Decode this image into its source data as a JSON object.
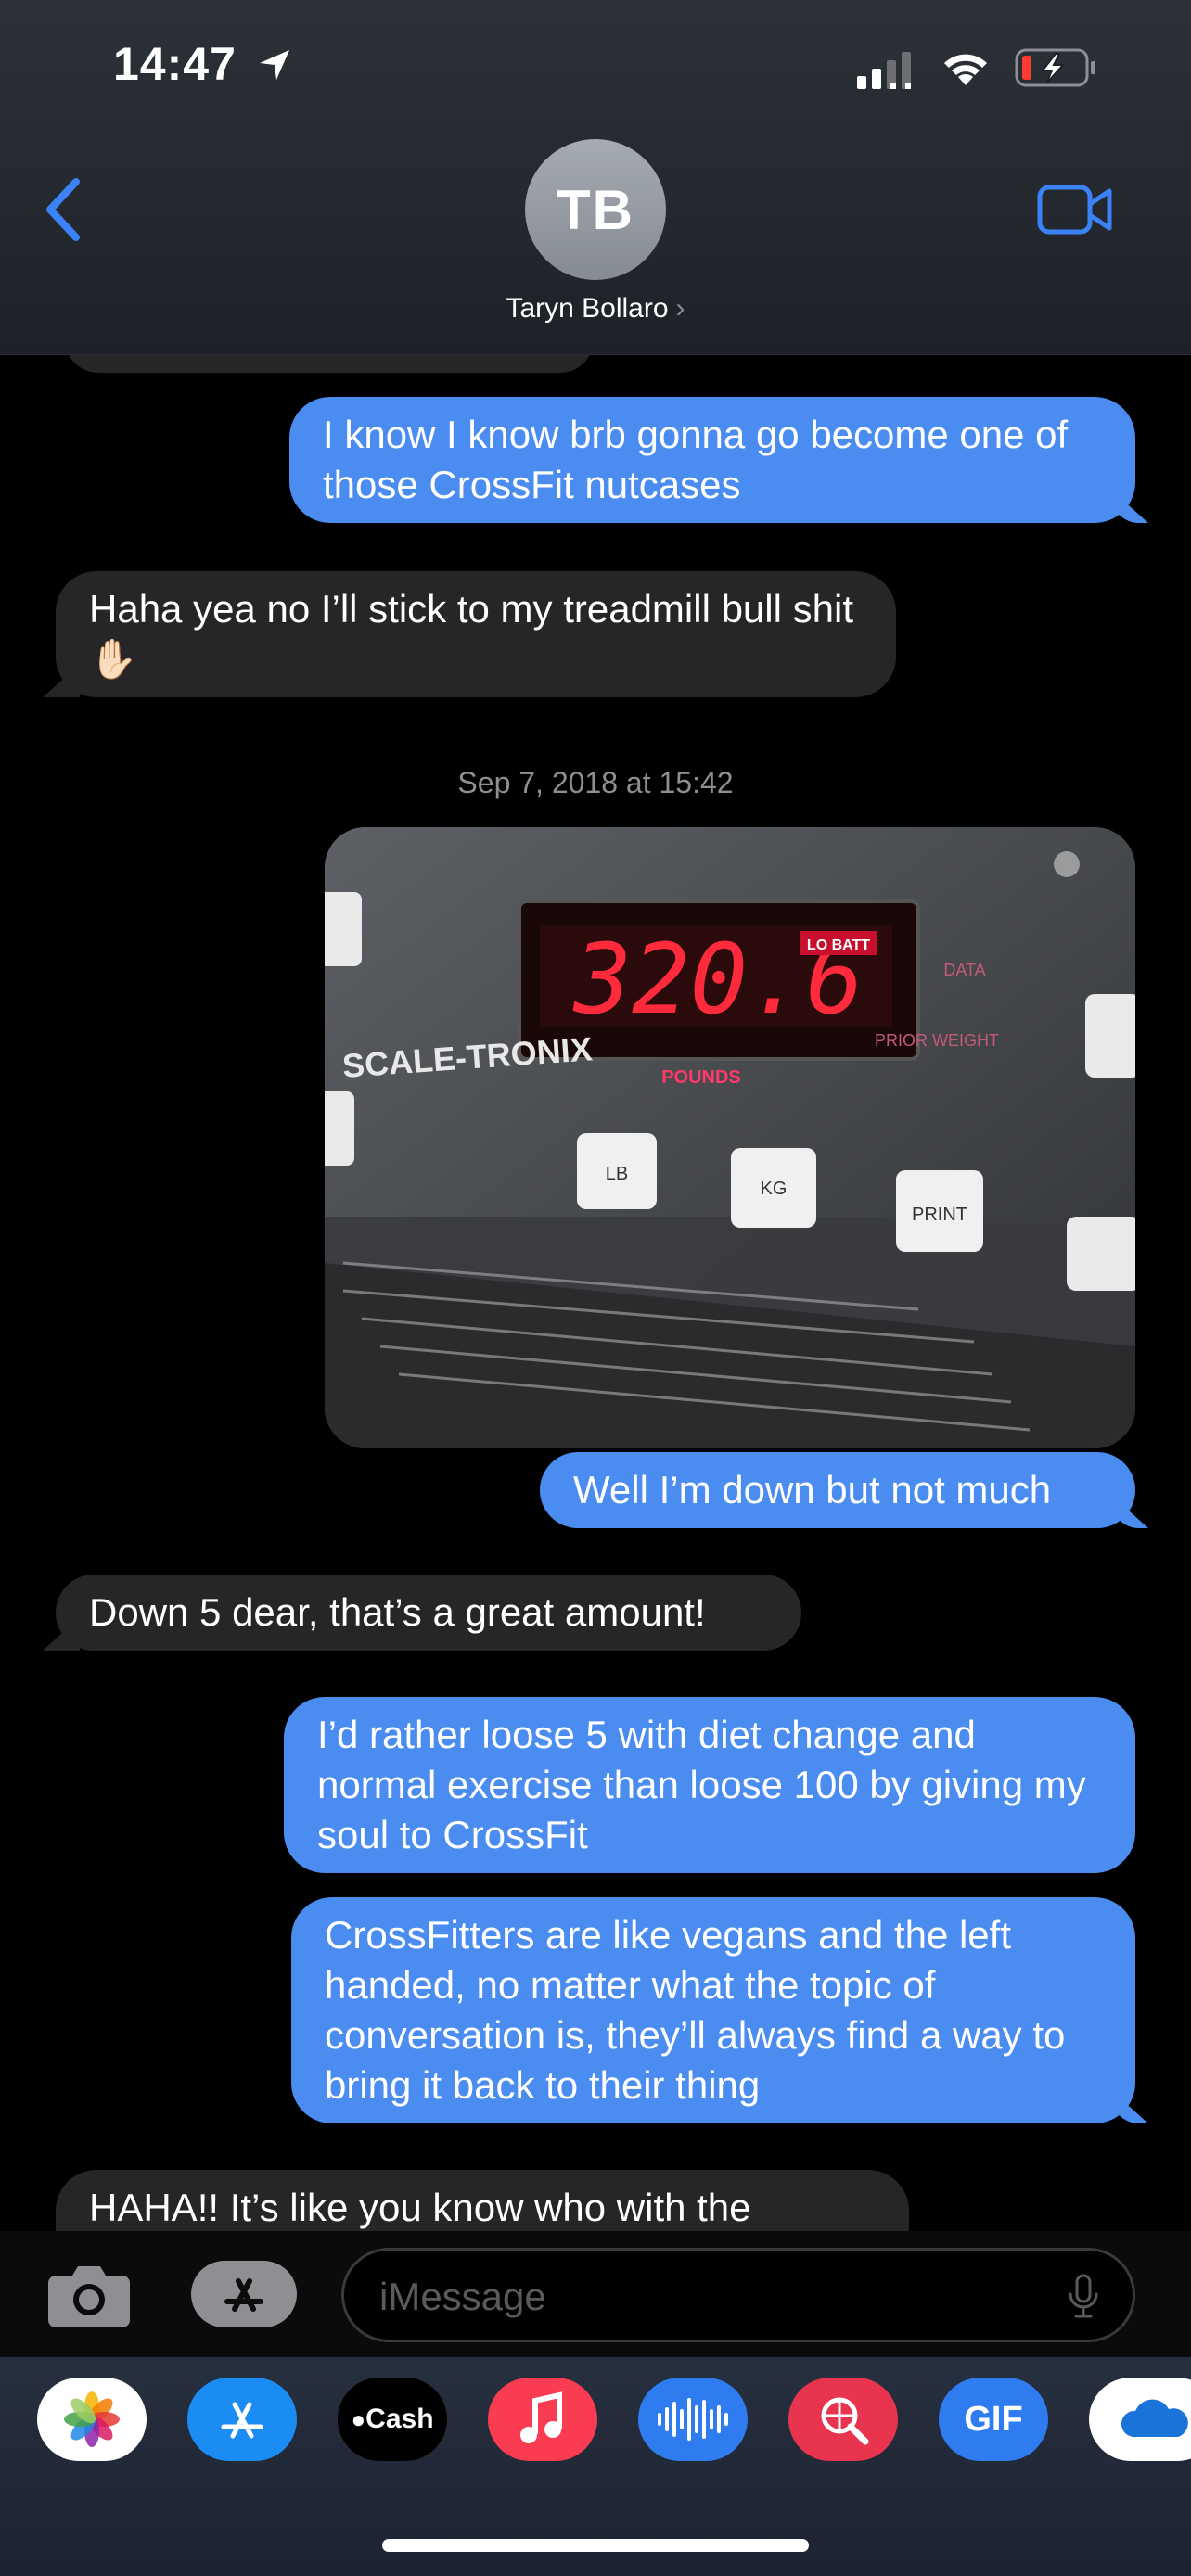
{
  "status_bar": {
    "time": "14:47"
  },
  "header": {
    "avatar_initials": "TB",
    "contact_name": "Taryn Bollaro"
  },
  "messages": [
    {
      "type": "sent",
      "text": "I know I know brb gonna go become one of those CrossFit nutcases"
    },
    {
      "type": "received",
      "text": "Haha yea no I’ll stick to my treadmill bull shit ✋🏻"
    },
    {
      "type": "timestamp",
      "text": "Sep 7, 2018 at 15:42"
    },
    {
      "type": "sent",
      "text": "Well I’m down but not much"
    },
    {
      "type": "received",
      "text": "Down 5 dear, that’s a great amount!"
    },
    {
      "type": "sent",
      "text": "I’d rather loose 5 with diet change and normal exercise than loose 100 by giving my soul to CrossFit"
    },
    {
      "type": "sent",
      "text": "CrossFitters are like vegans and the left handed, no matter what the topic of conversation is, they’ll always find a way to bring it back to their thing"
    },
    {
      "type": "received",
      "text": "HAHA!! It’s like you know who with the"
    }
  ],
  "photo": {
    "display_value": "320.6",
    "lo_batt": "LO BATT",
    "unit": "POUNDS",
    "brand": "SCALE-TRONIX",
    "buttons": [
      "LB",
      "KG",
      "PRINT"
    ],
    "side_labels": [
      "DATA",
      "PRIOR WEIGHT"
    ]
  },
  "input": {
    "placeholder": "iMessage"
  },
  "apps": [
    "Photos",
    "App Store",
    "Cash",
    "Music",
    "Audio",
    "Search",
    "GIF",
    "OneDrive"
  ],
  "apps_cash_label": "Cash",
  "apps_gif_label": "GIF"
}
